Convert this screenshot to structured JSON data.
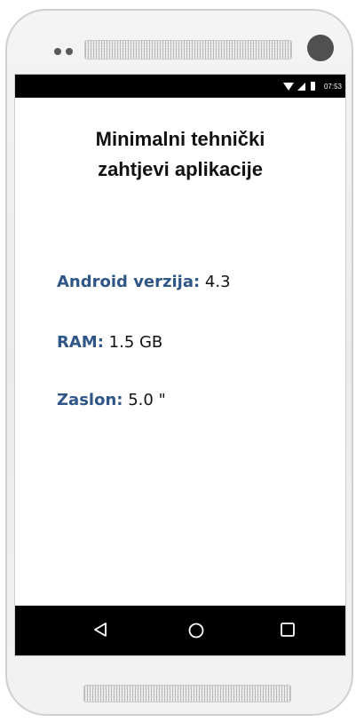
{
  "status_bar": {
    "time": "07:53",
    "icons": [
      "wifi-icon",
      "cell-signal-icon",
      "battery-icon"
    ]
  },
  "screen": {
    "title_line1": "Minimalni tehnički",
    "title_line2": "zahtjevi aplikacije",
    "specs": [
      {
        "label": "Android verzija",
        "separator": ":",
        "value": "4.3"
      },
      {
        "label": "RAM:",
        "separator": "",
        "value": "1.5 GB"
      },
      {
        "label": "Zaslon:",
        "separator": "",
        "value": "5.0 \""
      }
    ]
  },
  "nav_bar": {
    "buttons": [
      "back-icon",
      "home-icon",
      "recents-icon"
    ]
  },
  "colors": {
    "label_accent": "#2f5686",
    "bar_background": "#000000"
  }
}
